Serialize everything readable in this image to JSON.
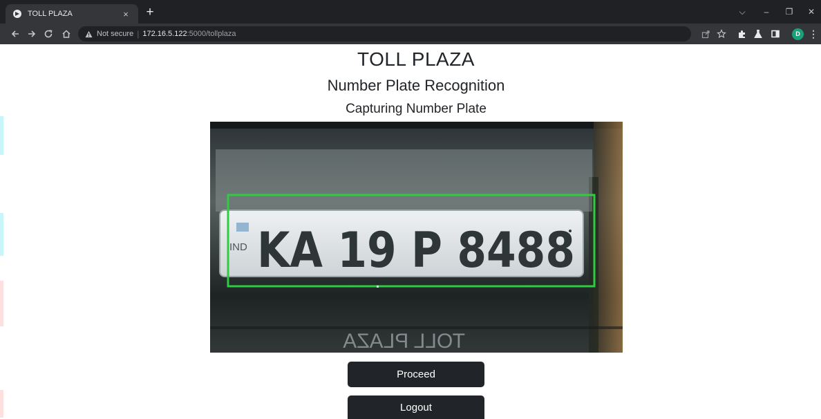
{
  "browser": {
    "tab_title": "TOLL PLAZA",
    "tab_close": "×",
    "new_tab": "+",
    "security_label": "Not secure",
    "url_separator": "|",
    "url_host": "172.16.5.122",
    "url_rest": ":5000/tollplaza",
    "profile_initial": "D",
    "menu_glyph": "⋮",
    "window_dropdown": "⌵",
    "window_minimize": "–",
    "window_restore": "❐",
    "window_close": "✕"
  },
  "page": {
    "title": "TOLL PLAZA",
    "subtitle": "Number Plate Recognition",
    "status": "Capturing Number Plate"
  },
  "camera": {
    "plate_prefix": "IND",
    "plate_number": "KA 19 P 8488",
    "reflection_text": "TOLL PLAZA",
    "detection_box_color": "#2ecc40"
  },
  "actions": {
    "proceed_label": "Proceed",
    "logout_label": "Logout"
  },
  "colors": {
    "button_bg": "#212529",
    "chrome_dark": "#202124",
    "chrome_toolbar": "#35363a"
  }
}
